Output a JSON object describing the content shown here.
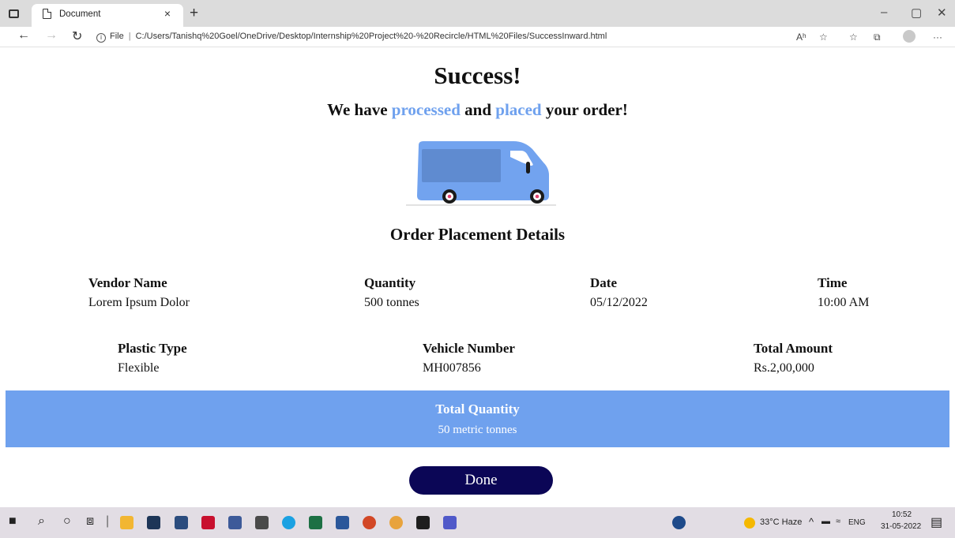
{
  "browser": {
    "tab_title": "Document",
    "tab_close": "×",
    "new_tab": "+",
    "url_info": "i",
    "url_prefix": "File",
    "url_separator": "|",
    "url": "C:/Users/Tanishq%20Goel/OneDrive/Desktop/Internship%20Project%20-%20Recircle/HTML%20Files/SuccessInward.html",
    "minimize": "–",
    "restore": "▢",
    "close": "✕",
    "back": "←",
    "forward": "→",
    "refresh": "↻",
    "read_aloud": "Aʰ",
    "more": "···"
  },
  "page": {
    "title": "Success!",
    "subtitle_pre": "We have ",
    "subtitle_accent1": "processed",
    "subtitle_mid": " and ",
    "subtitle_accent2": "placed",
    "subtitle_post": " your order!",
    "details_title": "Order Placement Details"
  },
  "details": {
    "vendor_name": {
      "label": "Vendor Name",
      "value": "Lorem Ipsum Dolor"
    },
    "quantity": {
      "label": "Quantity",
      "value": "500 tonnes"
    },
    "date": {
      "label": "Date",
      "value": "05/12/2022"
    },
    "time": {
      "label": "Time",
      "value": "10:00 AM"
    },
    "plastic_type": {
      "label": "Plastic Type",
      "value": "Flexible"
    },
    "vehicle_number": {
      "label": "Vehicle Number",
      "value": "MH007856"
    },
    "total_amount": {
      "label": "Total Amount",
      "value": "Rs.2,00,000"
    }
  },
  "total": {
    "label": "Total Quantity",
    "value": "50 metric tonnes"
  },
  "done_label": "Done",
  "taskbar": {
    "weather": "33°C Haze",
    "lang": "ENG",
    "time": "10:52",
    "date": "31-05-2022"
  },
  "colors": {
    "accent": "#6fa1ee",
    "button": "#0b0656",
    "van_body": "#72a3ef",
    "van_window": "#5f8bd0"
  }
}
